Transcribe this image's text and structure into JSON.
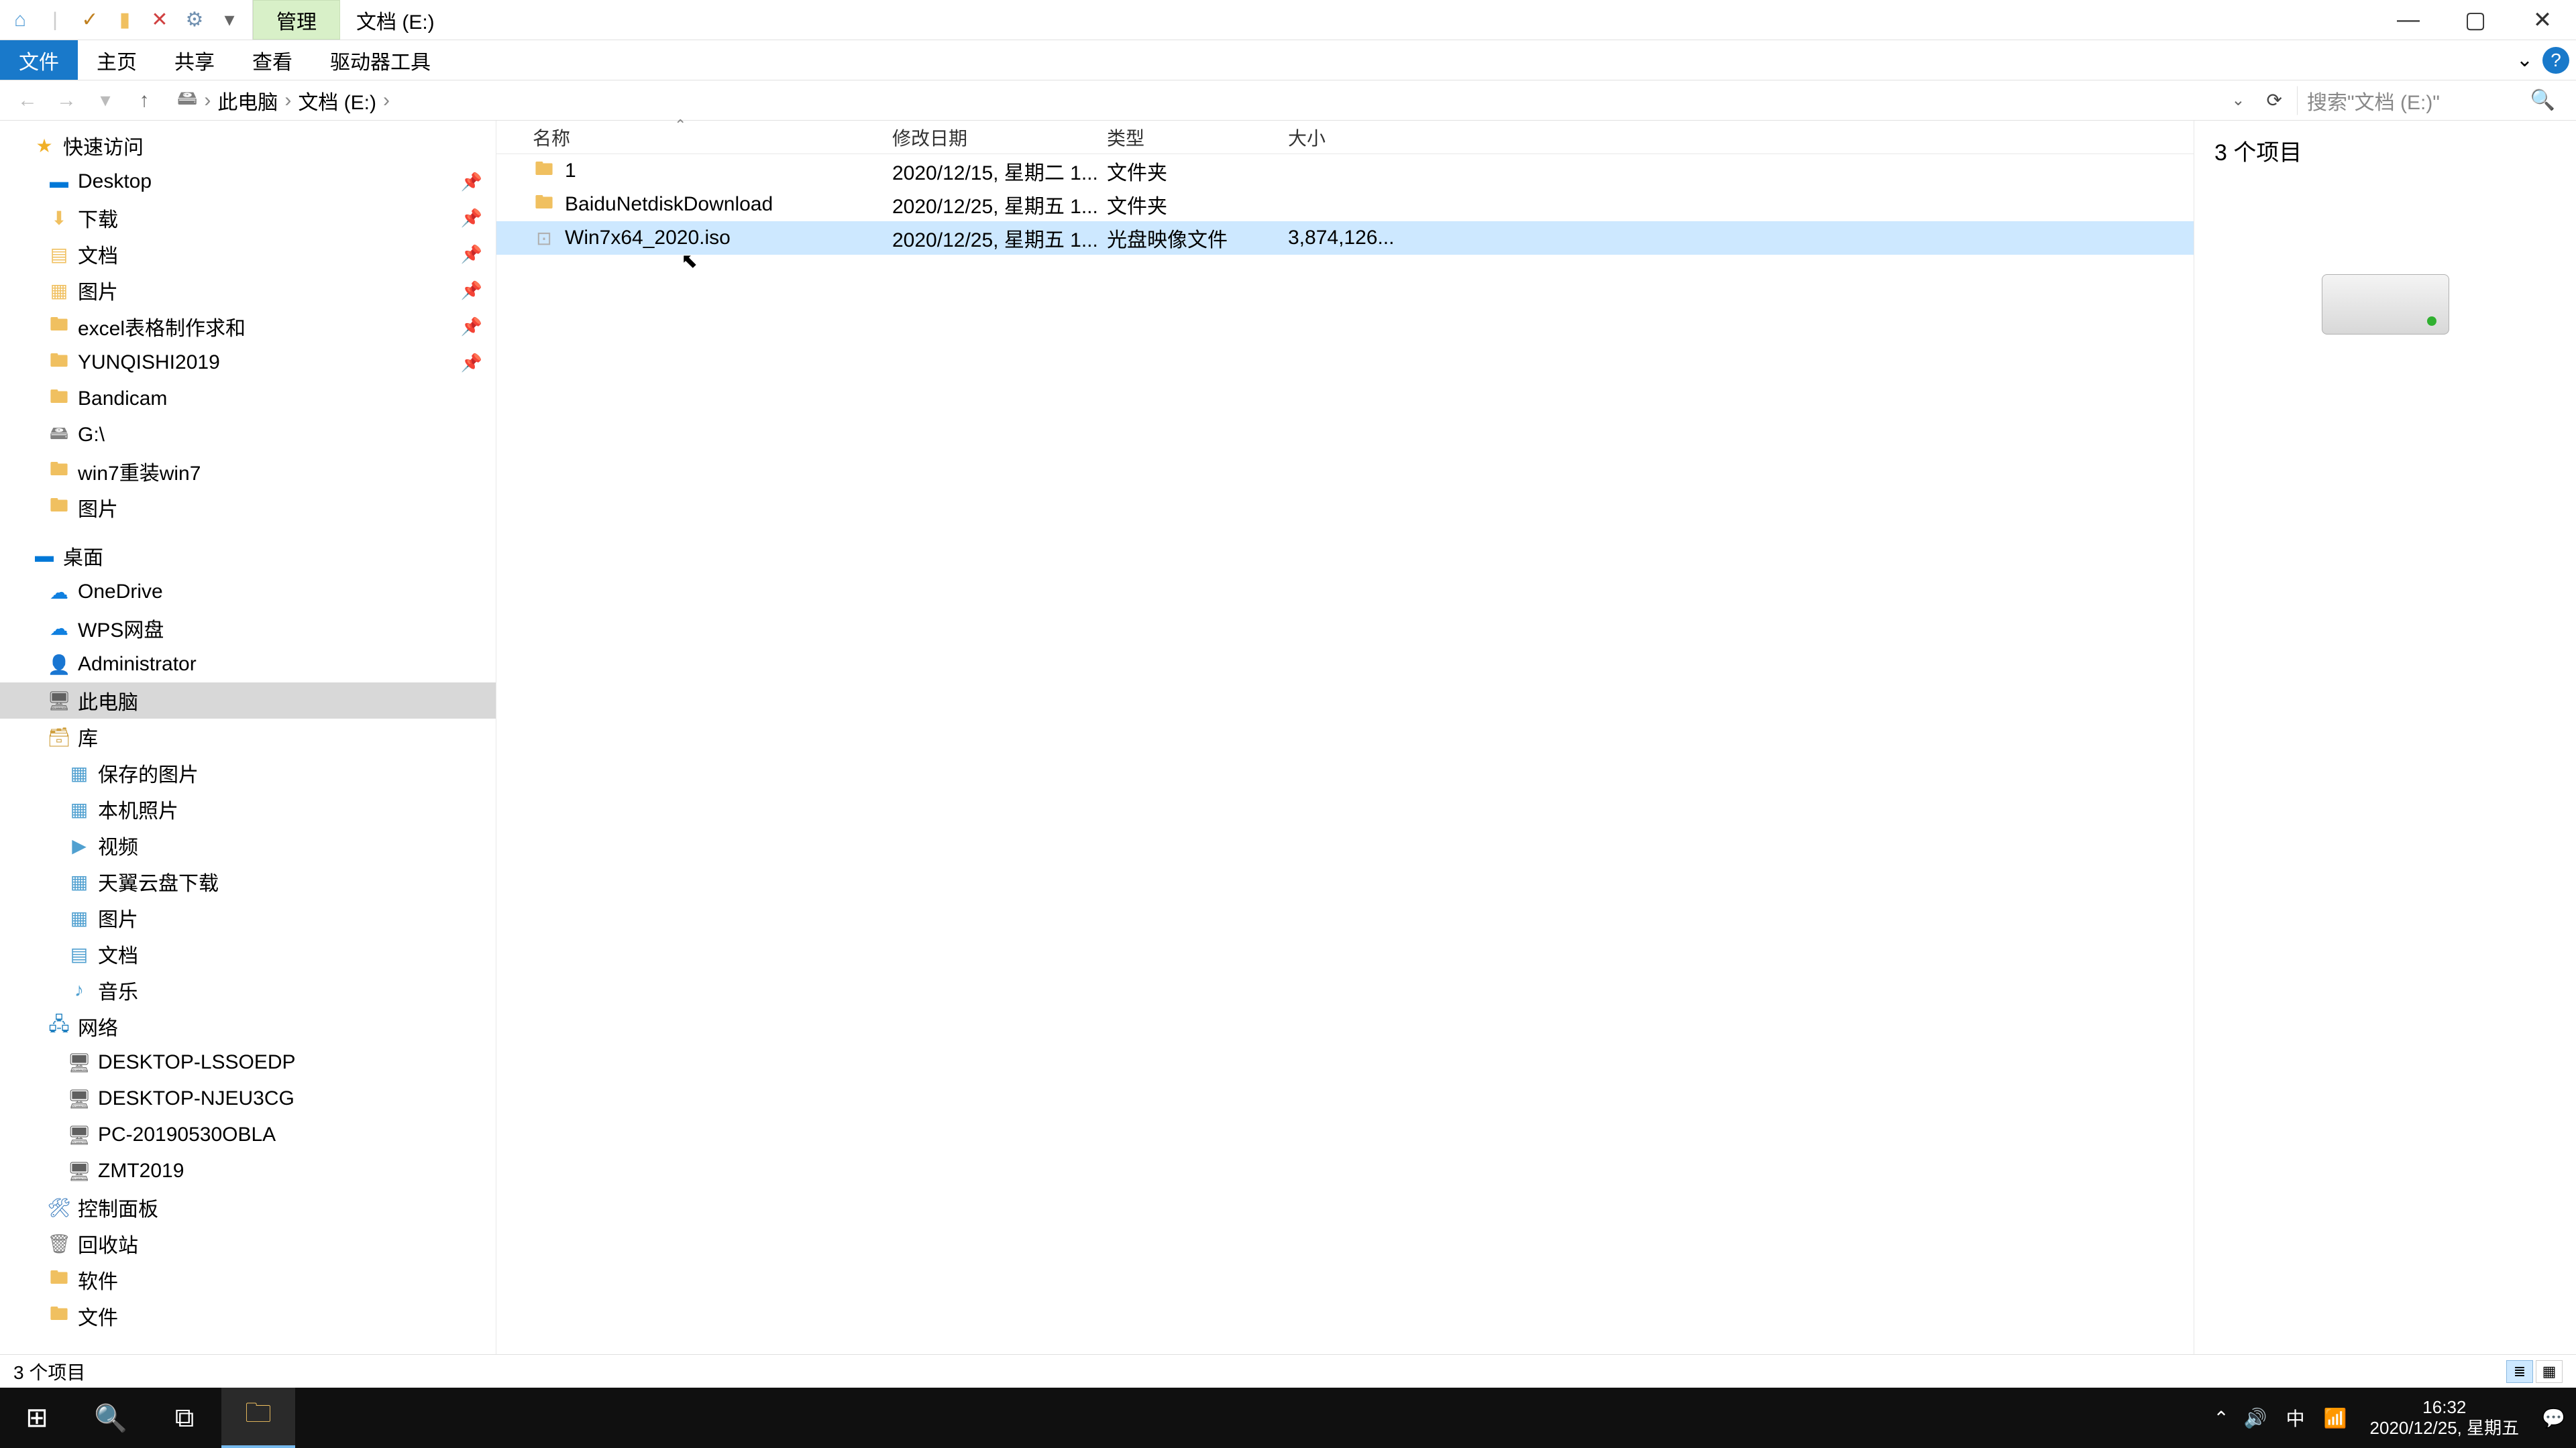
{
  "title": {
    "contextTab": "管理",
    "windowTitle": "文档 (E:)"
  },
  "ribbon": {
    "file": "文件",
    "home": "主页",
    "share": "共享",
    "view": "查看",
    "driveTools": "驱动器工具"
  },
  "addr": {
    "nav": {
      "back": "←",
      "forward": "→",
      "up": "↑"
    },
    "crumbs": [
      "此电脑",
      "文档 (E:)"
    ],
    "searchPlaceholder": "搜索\"文档 (E:)\""
  },
  "columns": {
    "name": "名称",
    "date": "修改日期",
    "type": "类型",
    "size": "大小"
  },
  "files": [
    {
      "name": "1",
      "date": "2020/12/15, 星期二 1...",
      "type": "文件夹",
      "size": "",
      "icon": "folder"
    },
    {
      "name": "BaiduNetdiskDownload",
      "date": "2020/12/25, 星期五 1...",
      "type": "文件夹",
      "size": "",
      "icon": "folder"
    },
    {
      "name": "Win7x64_2020.iso",
      "date": "2020/12/25, 星期五 1...",
      "type": "光盘映像文件",
      "size": "3,874,126...",
      "icon": "iso",
      "selected": true
    }
  ],
  "preview": {
    "count": "3 个项目"
  },
  "nav": {
    "quick": {
      "label": "快速访问",
      "items": [
        "Desktop",
        "下载",
        "文档",
        "图片",
        "excel表格制作求和",
        "YUNQISHI2019",
        "Bandicam",
        "G:\\",
        "win7重装win7",
        "图片"
      ]
    },
    "desktop": {
      "label": "桌面",
      "items": [
        "OneDrive",
        "WPS网盘",
        "Administrator",
        "此电脑",
        "库"
      ],
      "libItems": [
        "保存的图片",
        "本机照片",
        "视频",
        "天翼云盘下载",
        "图片",
        "文档",
        "音乐"
      ],
      "net": {
        "label": "网络",
        "items": [
          "DESKTOP-LSSOEDP",
          "DESKTOP-NJEU3CG",
          "PC-20190530OBLA",
          "ZMT2019"
        ]
      },
      "control": "控制面板",
      "recycle": "回收站",
      "software": "软件",
      "docs": "文件"
    }
  },
  "status": {
    "left": "3 个项目"
  },
  "taskbar": {
    "tray": {
      "ime": "中",
      "time": "16:32",
      "date": "2020/12/25, 星期五"
    }
  }
}
